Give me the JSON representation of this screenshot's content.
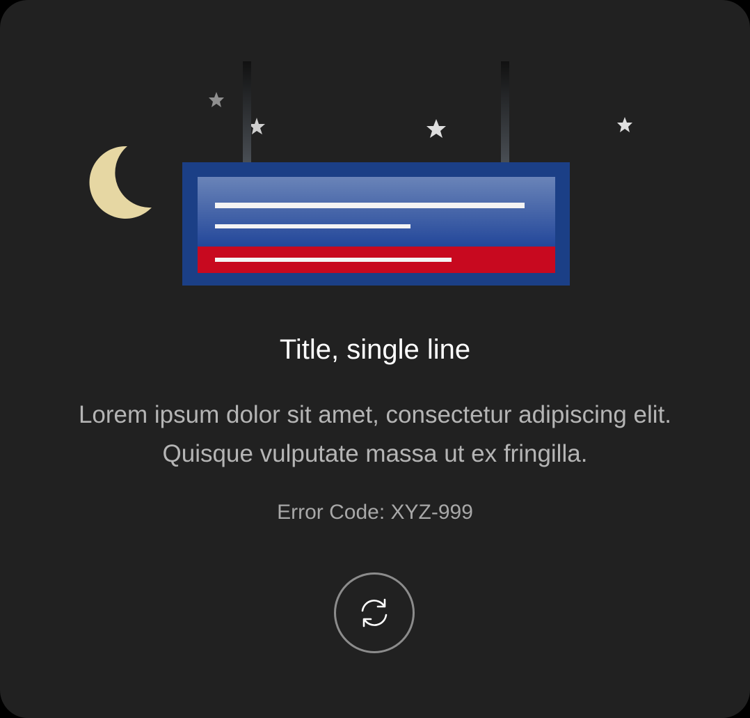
{
  "dialog": {
    "title": "Title, single line",
    "description": "Lorem ipsum dolor sit amet, consectetur adipiscing elit. Quisque vulputate massa ut ex fringilla.",
    "error_code": "Error Code: XYZ-999",
    "refresh_icon": "refresh-icon"
  },
  "illustration": {
    "elements": [
      "moon-icon",
      "star-icon",
      "hanging-sign"
    ],
    "colors": {
      "background": "#212121",
      "sign_blue": "#1b3f86",
      "sign_red": "#c8091f",
      "moon": "#e7d8a5",
      "star": "#d8d8d8"
    }
  }
}
